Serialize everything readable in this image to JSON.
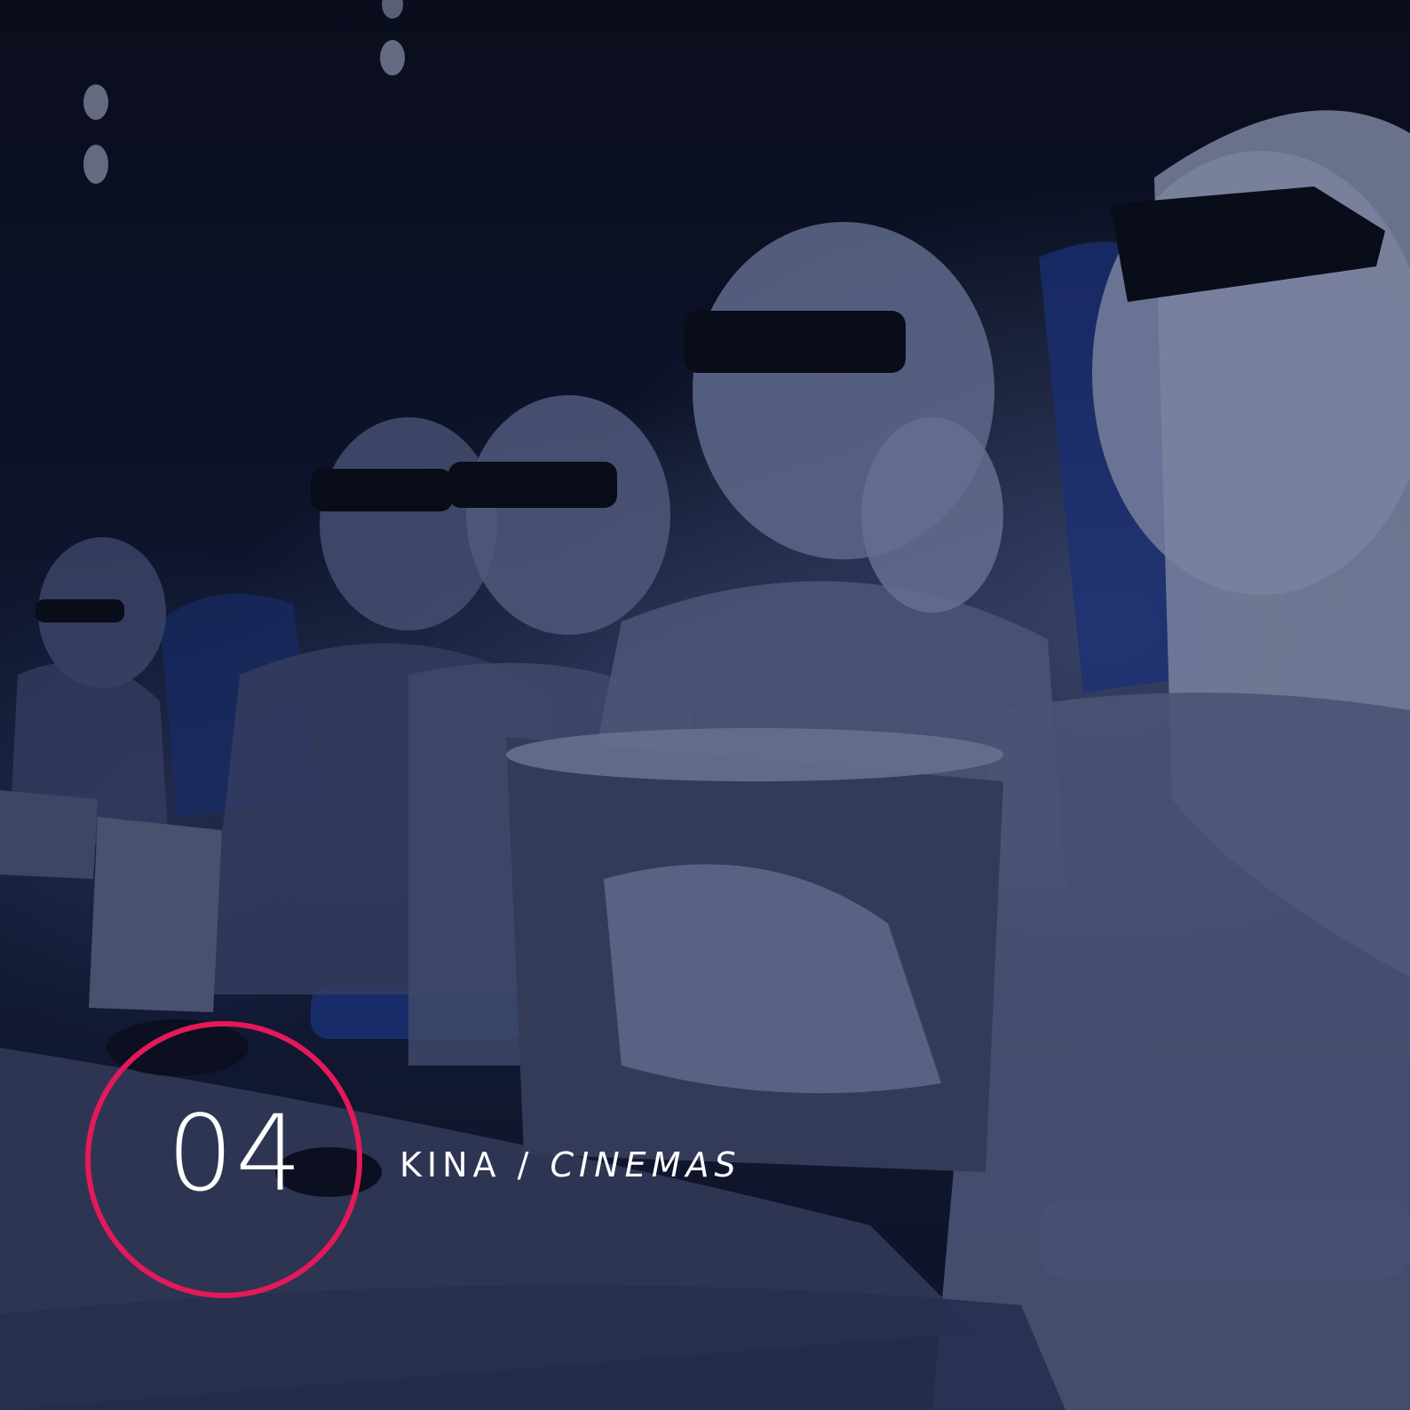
{
  "badge": {
    "number": "04",
    "ring_color": "#e5195a"
  },
  "caption": {
    "primary": "KINA",
    "separator": " / ",
    "secondary": "CINEMAS"
  },
  "photo": {
    "tint_color": "#1a2346"
  }
}
